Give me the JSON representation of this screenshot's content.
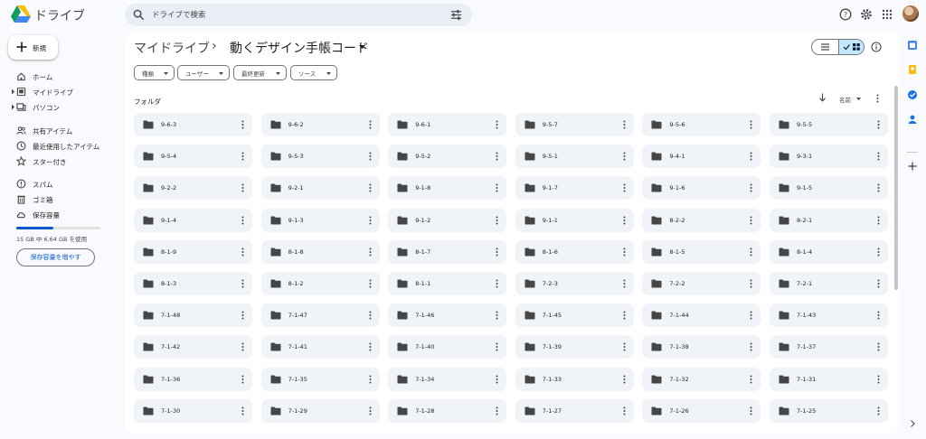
{
  "app": {
    "name": "ドライブ"
  },
  "search": {
    "placeholder": "ドライブで検索"
  },
  "sidebar": {
    "new_label": "新規",
    "items": [
      {
        "label": "ホーム",
        "icon": "home-icon"
      },
      {
        "label": "マイドライブ",
        "icon": "my-drive-icon"
      },
      {
        "label": "パソコン",
        "icon": "computers-icon"
      },
      {
        "label": "共有アイテム",
        "icon": "shared-icon"
      },
      {
        "label": "最近使用したアイテム",
        "icon": "recent-icon"
      },
      {
        "label": "スター付き",
        "icon": "star-icon"
      },
      {
        "label": "スパム",
        "icon": "spam-icon"
      },
      {
        "label": "ゴミ箱",
        "icon": "trash-icon"
      },
      {
        "label": "保存容量",
        "icon": "cloud-icon"
      }
    ],
    "storage_text": "15 GB 中 6.64 GB を使用",
    "storage_fraction": 0.443,
    "more_storage_label": "保存容量を増やす"
  },
  "breadcrumb": {
    "root": "マイドライブ",
    "separator": "›",
    "current": "動くデザイン手帳コード"
  },
  "filters": [
    {
      "label": "種類"
    },
    {
      "label": "ユーザー"
    },
    {
      "label": "最終更新"
    },
    {
      "label": "ソース"
    }
  ],
  "section": {
    "label": "フォルダ",
    "sort_label": "名前"
  },
  "folders": [
    "9-6-3",
    "9-6-2",
    "9-6-1",
    "9-5-7",
    "9-5-6",
    "9-5-5",
    "9-5-4",
    "9-5-3",
    "9-5-2",
    "9-5-1",
    "9-4-1",
    "9-3-1",
    "9-2-2",
    "9-2-1",
    "9-1-8",
    "9-1-7",
    "9-1-6",
    "9-1-5",
    "9-1-4",
    "9-1-3",
    "9-1-2",
    "9-1-1",
    "8-2-2",
    "8-2-1",
    "8-1-9",
    "8-1-8",
    "8-1-7",
    "8-1-6",
    "8-1-5",
    "8-1-4",
    "8-1-3",
    "8-1-2",
    "8-1-1",
    "7-2-3",
    "7-2-2",
    "7-2-1",
    "7-1-48",
    "7-1-47",
    "7-1-46",
    "7-1-45",
    "7-1-44",
    "7-1-43",
    "7-1-42",
    "7-1-41",
    "7-1-40",
    "7-1-39",
    "7-1-38",
    "7-1-37",
    "7-1-36",
    "7-1-35",
    "7-1-34",
    "7-1-33",
    "7-1-32",
    "7-1-31",
    "7-1-30",
    "7-1-29",
    "7-1-28",
    "7-1-27",
    "7-1-26",
    "7-1-25"
  ],
  "colors": {
    "accent": "#0b57d0",
    "selected_toggle": "#c2e7ff",
    "folder_tile": "#f0f4f9"
  }
}
